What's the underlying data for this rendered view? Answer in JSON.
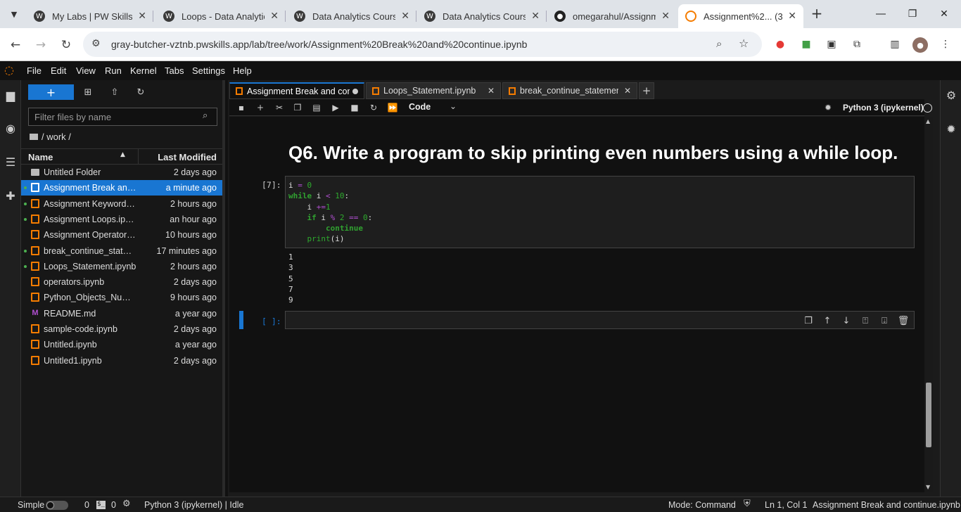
{
  "browser": {
    "tabs": [
      {
        "title": "My Labs | PW Skills",
        "icon": "wordpress-icon"
      },
      {
        "title": "Loops - Data Analytic",
        "icon": "wordpress-icon"
      },
      {
        "title": "Data Analytics Course",
        "icon": "wordpress-icon"
      },
      {
        "title": "Data Analytics Course",
        "icon": "wordpress-icon"
      },
      {
        "title": "omegarahul/Assignm",
        "icon": "github-icon"
      },
      {
        "title": "Assignment%2... (3)",
        "icon": "jupyter-icon",
        "active": true
      }
    ],
    "new_tab": "+",
    "url": "gray-butcher-vztnb.pwskills.app/lab/tree/work/Assignment%20Break%20and%20continue.ipynb"
  },
  "jupyter": {
    "menu": [
      "File",
      "Edit",
      "View",
      "Run",
      "Kernel",
      "Tabs",
      "Settings",
      "Help"
    ],
    "filebrowser": {
      "new_label": "+",
      "filter_placeholder": "Filter files by name",
      "breadcrumb": "/ work /",
      "col_name": "Name",
      "col_modified": "Last Modified",
      "files": [
        {
          "name": "Untitled Folder",
          "modified": "2 days ago",
          "type": "folder",
          "running": false,
          "selected": false
        },
        {
          "name": "Assignment Break and c...",
          "modified": "a minute ago",
          "type": "notebook",
          "running": true,
          "selected": true
        },
        {
          "name": "Assignment Keywords.i...",
          "modified": "2 hours ago",
          "type": "notebook",
          "running": true,
          "selected": false
        },
        {
          "name": "Assignment Loops.ipynb",
          "modified": "an hour ago",
          "type": "notebook",
          "running": true,
          "selected": false
        },
        {
          "name": "Assignment Operators.i...",
          "modified": "10 hours ago",
          "type": "notebook",
          "running": false,
          "selected": false
        },
        {
          "name": "break_continue_statem...",
          "modified": "17 minutes ago",
          "type": "notebook",
          "running": true,
          "selected": false
        },
        {
          "name": "Loops_Statement.ipynb",
          "modified": "2 hours ago",
          "type": "notebook",
          "running": true,
          "selected": false
        },
        {
          "name": "operators.ipynb",
          "modified": "2 days ago",
          "type": "notebook",
          "running": false,
          "selected": false
        },
        {
          "name": "Python_Objects_Numb...",
          "modified": "9 hours ago",
          "type": "notebook",
          "running": false,
          "selected": false
        },
        {
          "name": "README.md",
          "modified": "a year ago",
          "type": "markdown",
          "running": false,
          "selected": false
        },
        {
          "name": "sample-code.ipynb",
          "modified": "2 days ago",
          "type": "notebook",
          "running": false,
          "selected": false
        },
        {
          "name": "Untitled.ipynb",
          "modified": "a year ago",
          "type": "notebook",
          "running": false,
          "selected": false
        },
        {
          "name": "Untitled1.ipynb",
          "modified": "2 days ago",
          "type": "notebook",
          "running": false,
          "selected": false
        }
      ]
    },
    "doc_tabs": [
      {
        "title": "Assignment Break and contir",
        "dirty": true,
        "active": true
      },
      {
        "title": "Loops_Statement.ipynb",
        "dirty": false,
        "active": false
      },
      {
        "title": "break_continue_statements_",
        "dirty": false,
        "active": false
      }
    ],
    "toolbar": {
      "cell_type": "Code",
      "kernel": "Python 3 (ipykernel)"
    },
    "notebook": {
      "heading": "Q6. Write a program to skip printing even numbers using a while loop.",
      "cell1_prompt": "[7]:",
      "cell1_output": [
        "1",
        "3",
        "5",
        "7",
        "9"
      ],
      "cell2_prompt": "[ ]:"
    },
    "statusbar": {
      "mode_simple": "Simple",
      "terminals": "0",
      "kernels": "0",
      "kernel_status": "Python 3 (ipykernel) | Idle",
      "mode": "Mode: Command",
      "position": "Ln 1, Col 1",
      "file": "Assignment Break and continue.ipynb"
    }
  },
  "colors": {
    "accent": "#1976d2",
    "notebook_icon": "#f57c00",
    "keyword": "#30a130",
    "operator": "#b04fd0"
  }
}
